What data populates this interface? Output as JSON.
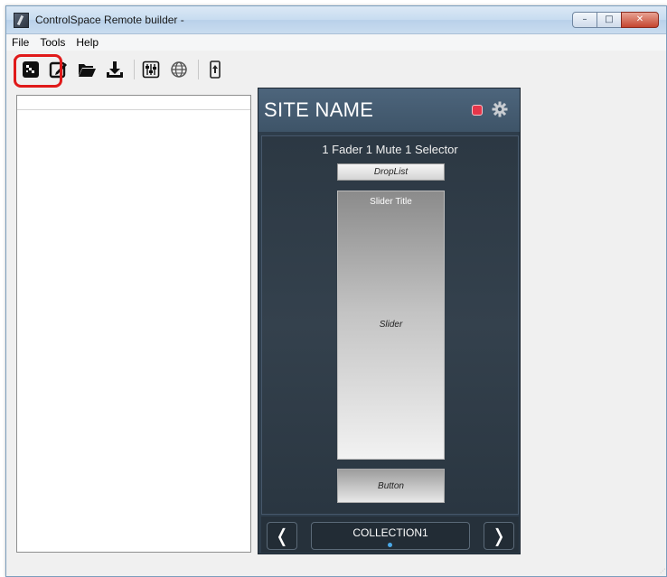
{
  "window": {
    "title": "ControlSpace Remote builder -",
    "minimize_glyph": "–",
    "maximize_glyph": "□",
    "close_glyph": "✕"
  },
  "menu": {
    "items": [
      {
        "label": "File"
      },
      {
        "label": "Tools"
      },
      {
        "label": "Help"
      }
    ]
  },
  "toolbar": {
    "buttons": [
      {
        "icon": "new-project-icon",
        "highlighted": true
      },
      {
        "icon": "edit-icon"
      },
      {
        "icon": "open-folder-icon"
      },
      {
        "icon": "download-icon"
      },
      {
        "icon": "mixer-settings-icon"
      },
      {
        "icon": "globe-icon"
      },
      {
        "icon": "upload-device-icon"
      }
    ],
    "highlight_color": "#e01a1a"
  },
  "preview": {
    "site_name": "SITE NAME",
    "stop_icon_color": "#e6364a",
    "page_title": "1 Fader 1 Mute 1 Selector",
    "droplist_label": "DropList",
    "slider_title": "Slider Title",
    "slider_label": "Slider",
    "button_label": "Button",
    "nav": {
      "prev_glyph": "❬",
      "next_glyph": "❭",
      "collection_label": "COLLECTION1",
      "dot_color": "#4aa8e8"
    }
  },
  "colors": {
    "header_bg": "#4d657c",
    "content_bg": "#2e3d4b"
  }
}
